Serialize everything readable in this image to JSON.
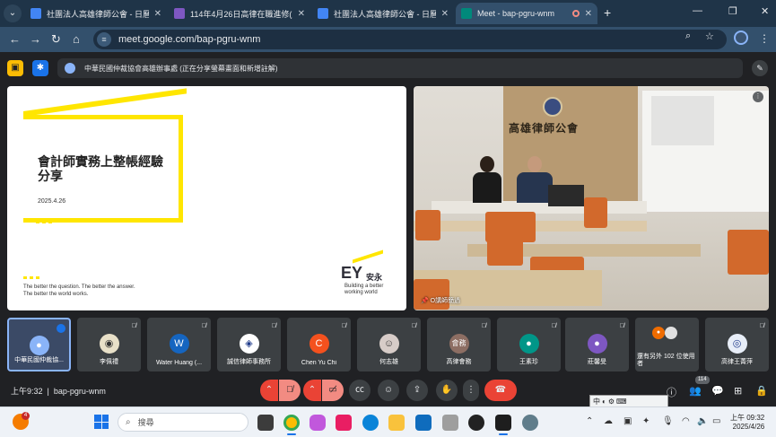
{
  "browser": {
    "tabs": [
      {
        "title": "社團法人高雄律師公會 - 日曆 -",
        "favicon_color": "#4285f4",
        "active": false
      },
      {
        "title": "114年4月26日高律在職進修(財",
        "favicon_color": "#7e57c2",
        "active": false
      },
      {
        "title": "社團法人高雄律師公會 - 日曆 -",
        "favicon_color": "#4285f4",
        "active": false
      },
      {
        "title": "Meet - bap-pgru-wnm",
        "favicon_color": "#00897b",
        "active": true
      }
    ],
    "url": "meet.google.com/bap-pgru-wnm"
  },
  "meet": {
    "presenter_text": "中華民國仲裁協會高雄辦事處 (正在分享螢幕畫面和新增註解)",
    "slide": {
      "title_line1": "會計師實務上整帳經驗",
      "title_line2": "分享",
      "date": "2025.4.26",
      "tagline1": "The better the question. The better the answer.",
      "tagline2": "The better the world works.",
      "logo_text": "EY",
      "logo_cn": "安永",
      "logo_sub1": "Building a better",
      "logo_sub2": "working world"
    },
    "camera": {
      "wall_text": "高雄律師公會",
      "speaker_label": "O講師簡過"
    },
    "participants": [
      {
        "name": "中華民國仲裁協...",
        "avatar": "",
        "color": "#8ab4f8",
        "speaking": true
      },
      {
        "name": "李佩禮",
        "avatar": "",
        "color": "#7a8b5a",
        "speaking": false
      },
      {
        "name": "Water Huang (...",
        "avatar": "W",
        "color": "#1565c0",
        "speaking": false
      },
      {
        "name": "誠信律師事務所",
        "avatar": "",
        "color": "#e0e0e0",
        "speaking": false
      },
      {
        "name": "Chen Yu Chi",
        "avatar": "C",
        "color": "#f4511e",
        "speaking": false
      },
      {
        "name": "何志雄",
        "avatar": "",
        "color": "#d7ccc8",
        "speaking": false
      },
      {
        "name": "高律會務",
        "avatar": "會務",
        "color": "#8d6e63",
        "speaking": false
      },
      {
        "name": "王素珍",
        "avatar": "",
        "color": "#009688",
        "speaking": false
      },
      {
        "name": "莊馨旻",
        "avatar": "",
        "color": "#7e57c2",
        "speaking": false
      },
      {
        "name": "還有另外 102 位使用者",
        "avatar": "",
        "color": "#ef6c00",
        "speaking": false
      },
      {
        "name": "高律王菁萍",
        "avatar": "",
        "color": "#1e3a8a",
        "speaking": false
      }
    ],
    "meeting_time": "上午9:32",
    "meeting_code": "bap-pgru-wnm",
    "participant_count": "114"
  },
  "taskbar": {
    "notification_count": "4",
    "search_placeholder": "搜尋",
    "clock_time": "上午 09:32",
    "clock_date": "2025/4/26"
  }
}
